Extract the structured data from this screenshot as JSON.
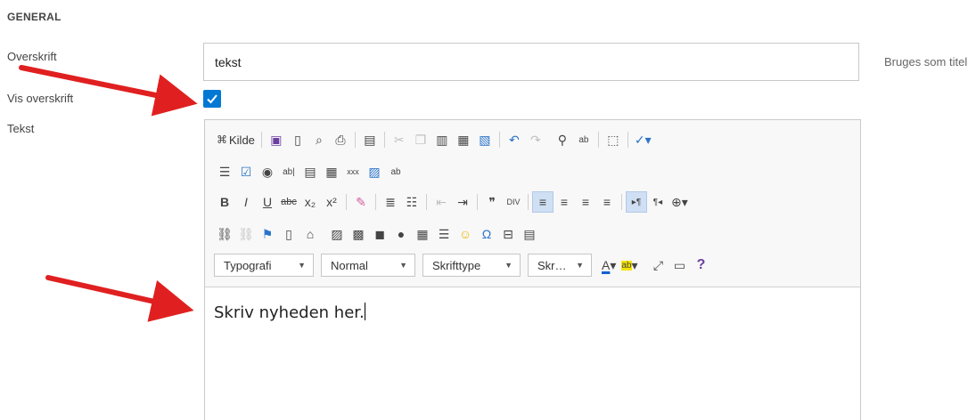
{
  "section": {
    "title": "GENERAL"
  },
  "fields": {
    "heading_label": "Overskrift",
    "heading_value": "tekst",
    "heading_hint": "Bruges som titel",
    "show_heading_label": "Vis overskrift",
    "show_heading_checked": true,
    "text_label": "Tekst"
  },
  "toolbar": {
    "source_label": "Kilde",
    "dropdowns": {
      "format": "Typografi",
      "style": "Normal",
      "font": "Skrifttype",
      "size": "Skr…"
    }
  },
  "editor": {
    "content": "Skriv nyheden her."
  },
  "colors": {
    "accent": "#0078d4",
    "arrow": "#e02020"
  }
}
